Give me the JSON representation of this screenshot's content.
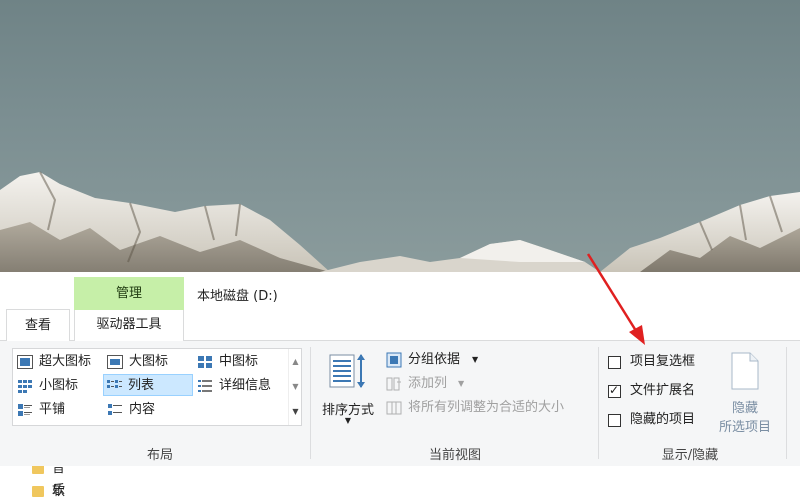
{
  "tabs": {
    "view": "查看",
    "context_group": "管理",
    "drive_tools": "驱动器工具"
  },
  "window_title": "本地磁盘 (D:)",
  "ribbon": {
    "layout": {
      "group_label": "布局",
      "items": [
        {
          "label": "超大图标",
          "icon": "extra-large-icons-icon"
        },
        {
          "label": "大图标",
          "icon": "large-icons-icon"
        },
        {
          "label": "中图标",
          "icon": "medium-icons-icon"
        },
        {
          "label": "小图标",
          "icon": "small-icons-icon"
        },
        {
          "label": "列表",
          "icon": "list-view-icon",
          "selected": true
        },
        {
          "label": "详细信息",
          "icon": "details-view-icon"
        },
        {
          "label": "平铺",
          "icon": "tiles-view-icon"
        },
        {
          "label": "内容",
          "icon": "content-view-icon"
        }
      ]
    },
    "current_view": {
      "group_label": "当前视图",
      "sort_by": "排序方式",
      "group_by": "分组依据",
      "add_columns": "添加列",
      "size_all_columns": "将所有列调整为合适的大小"
    },
    "show_hide": {
      "group_label": "显示/隐藏",
      "item_check_boxes": {
        "label": "项目复选框",
        "checked": false
      },
      "file_name_extensions": {
        "label": "文件扩展名",
        "checked": true
      },
      "hidden_items": {
        "label": "隐藏的项目",
        "checked": false
      },
      "hide_selected_line1": "隐藏",
      "hide_selected_line2": "所选项目"
    }
  },
  "nav_pane": {
    "items": [
      "音乐",
      "软件"
    ]
  },
  "colors": {
    "context_tab": "#c6efa8",
    "selection": "#cce8ff",
    "annotation_arrow": "#e02020"
  }
}
